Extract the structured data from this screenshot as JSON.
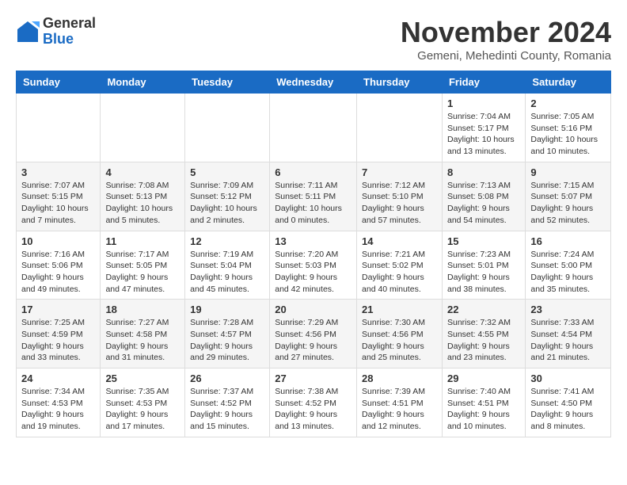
{
  "logo": {
    "general": "General",
    "blue": "Blue"
  },
  "title": "November 2024",
  "location": "Gemeni, Mehedinti County, Romania",
  "days_of_week": [
    "Sunday",
    "Monday",
    "Tuesday",
    "Wednesday",
    "Thursday",
    "Friday",
    "Saturday"
  ],
  "weeks": [
    [
      {
        "day": "",
        "info": ""
      },
      {
        "day": "",
        "info": ""
      },
      {
        "day": "",
        "info": ""
      },
      {
        "day": "",
        "info": ""
      },
      {
        "day": "",
        "info": ""
      },
      {
        "day": "1",
        "info": "Sunrise: 7:04 AM\nSunset: 5:17 PM\nDaylight: 10 hours\nand 13 minutes."
      },
      {
        "day": "2",
        "info": "Sunrise: 7:05 AM\nSunset: 5:16 PM\nDaylight: 10 hours\nand 10 minutes."
      }
    ],
    [
      {
        "day": "3",
        "info": "Sunrise: 7:07 AM\nSunset: 5:15 PM\nDaylight: 10 hours\nand 7 minutes."
      },
      {
        "day": "4",
        "info": "Sunrise: 7:08 AM\nSunset: 5:13 PM\nDaylight: 10 hours\nand 5 minutes."
      },
      {
        "day": "5",
        "info": "Sunrise: 7:09 AM\nSunset: 5:12 PM\nDaylight: 10 hours\nand 2 minutes."
      },
      {
        "day": "6",
        "info": "Sunrise: 7:11 AM\nSunset: 5:11 PM\nDaylight: 10 hours\nand 0 minutes."
      },
      {
        "day": "7",
        "info": "Sunrise: 7:12 AM\nSunset: 5:10 PM\nDaylight: 9 hours\nand 57 minutes."
      },
      {
        "day": "8",
        "info": "Sunrise: 7:13 AM\nSunset: 5:08 PM\nDaylight: 9 hours\nand 54 minutes."
      },
      {
        "day": "9",
        "info": "Sunrise: 7:15 AM\nSunset: 5:07 PM\nDaylight: 9 hours\nand 52 minutes."
      }
    ],
    [
      {
        "day": "10",
        "info": "Sunrise: 7:16 AM\nSunset: 5:06 PM\nDaylight: 9 hours\nand 49 minutes."
      },
      {
        "day": "11",
        "info": "Sunrise: 7:17 AM\nSunset: 5:05 PM\nDaylight: 9 hours\nand 47 minutes."
      },
      {
        "day": "12",
        "info": "Sunrise: 7:19 AM\nSunset: 5:04 PM\nDaylight: 9 hours\nand 45 minutes."
      },
      {
        "day": "13",
        "info": "Sunrise: 7:20 AM\nSunset: 5:03 PM\nDaylight: 9 hours\nand 42 minutes."
      },
      {
        "day": "14",
        "info": "Sunrise: 7:21 AM\nSunset: 5:02 PM\nDaylight: 9 hours\nand 40 minutes."
      },
      {
        "day": "15",
        "info": "Sunrise: 7:23 AM\nSunset: 5:01 PM\nDaylight: 9 hours\nand 38 minutes."
      },
      {
        "day": "16",
        "info": "Sunrise: 7:24 AM\nSunset: 5:00 PM\nDaylight: 9 hours\nand 35 minutes."
      }
    ],
    [
      {
        "day": "17",
        "info": "Sunrise: 7:25 AM\nSunset: 4:59 PM\nDaylight: 9 hours\nand 33 minutes."
      },
      {
        "day": "18",
        "info": "Sunrise: 7:27 AM\nSunset: 4:58 PM\nDaylight: 9 hours\nand 31 minutes."
      },
      {
        "day": "19",
        "info": "Sunrise: 7:28 AM\nSunset: 4:57 PM\nDaylight: 9 hours\nand 29 minutes."
      },
      {
        "day": "20",
        "info": "Sunrise: 7:29 AM\nSunset: 4:56 PM\nDaylight: 9 hours\nand 27 minutes."
      },
      {
        "day": "21",
        "info": "Sunrise: 7:30 AM\nSunset: 4:56 PM\nDaylight: 9 hours\nand 25 minutes."
      },
      {
        "day": "22",
        "info": "Sunrise: 7:32 AM\nSunset: 4:55 PM\nDaylight: 9 hours\nand 23 minutes."
      },
      {
        "day": "23",
        "info": "Sunrise: 7:33 AM\nSunset: 4:54 PM\nDaylight: 9 hours\nand 21 minutes."
      }
    ],
    [
      {
        "day": "24",
        "info": "Sunrise: 7:34 AM\nSunset: 4:53 PM\nDaylight: 9 hours\nand 19 minutes."
      },
      {
        "day": "25",
        "info": "Sunrise: 7:35 AM\nSunset: 4:53 PM\nDaylight: 9 hours\nand 17 minutes."
      },
      {
        "day": "26",
        "info": "Sunrise: 7:37 AM\nSunset: 4:52 PM\nDaylight: 9 hours\nand 15 minutes."
      },
      {
        "day": "27",
        "info": "Sunrise: 7:38 AM\nSunset: 4:52 PM\nDaylight: 9 hours\nand 13 minutes."
      },
      {
        "day": "28",
        "info": "Sunrise: 7:39 AM\nSunset: 4:51 PM\nDaylight: 9 hours\nand 12 minutes."
      },
      {
        "day": "29",
        "info": "Sunrise: 7:40 AM\nSunset: 4:51 PM\nDaylight: 9 hours\nand 10 minutes."
      },
      {
        "day": "30",
        "info": "Sunrise: 7:41 AM\nSunset: 4:50 PM\nDaylight: 9 hours\nand 8 minutes."
      }
    ]
  ]
}
